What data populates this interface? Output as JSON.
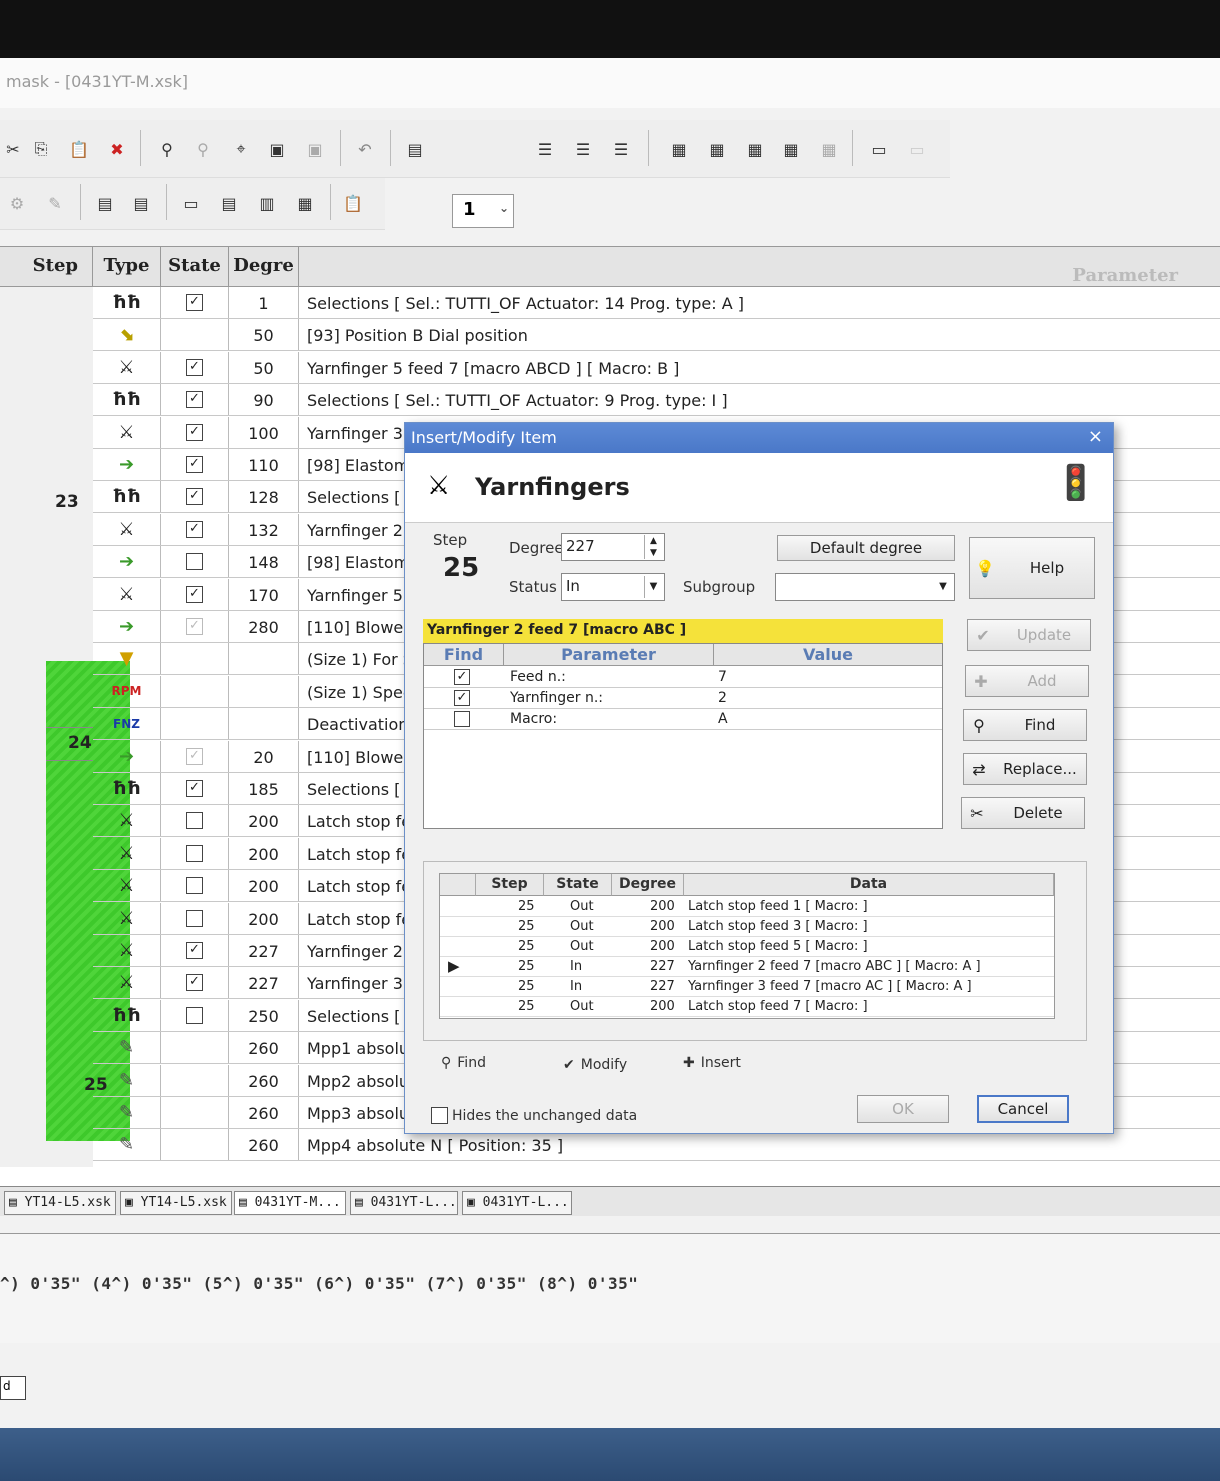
{
  "window_title": "mask - [0431YT-M.xsk]",
  "toolbar": {
    "page_combo_value": "1"
  },
  "grid": {
    "headers": {
      "step": "Step",
      "type": "Type",
      "state": "State",
      "degree": "Degre",
      "parameter": "Parameter"
    },
    "step_labels": {
      "s23": "23",
      "s24": "24",
      "s25": "25"
    },
    "rows": [
      {
        "type": "hh",
        "state": "checked",
        "degree": "1",
        "param": "Selections [ Sel.: TUTTI_OF Actuator: 14 Prog. type: A ]"
      },
      {
        "type": "dial",
        "state": "",
        "degree": "50",
        "param": "[93] Position B Dial position"
      },
      {
        "type": "yarn",
        "state": "checked",
        "degree": "50",
        "param": "Yarnfinger 5 feed 7 [macro ABCD ] [ Macro: B ]"
      },
      {
        "type": "hh",
        "state": "checked",
        "degree": "90",
        "param": "Selections [ Sel.: TUTTI_OF Actuator: 9 Prog. type: I ]"
      },
      {
        "type": "yarn",
        "state": "checked",
        "degree": "100",
        "param": "Yarnfinger 3"
      },
      {
        "type": "arrow",
        "state": "checked",
        "degree": "110",
        "param": "[98] Elastom"
      },
      {
        "type": "hh",
        "state": "checked",
        "degree": "128",
        "param": "Selections ["
      },
      {
        "type": "yarn",
        "state": "checked",
        "degree": "132",
        "param": "Yarnfinger 2"
      },
      {
        "type": "arrow",
        "state": "unchecked",
        "degree": "148",
        "param": "[98] Elastom"
      },
      {
        "type": "yarn",
        "state": "checked",
        "degree": "170",
        "param": "Yarnfinger 5"
      },
      {
        "type": "arrow",
        "state": "dim",
        "degree": "280",
        "param": "[110] Blower"
      },
      {
        "type": "size",
        "state": "",
        "degree": "",
        "param": "(Size 1) For S"
      },
      {
        "type": "rpm",
        "state": "",
        "degree": "",
        "param": "(Size 1) Spee"
      },
      {
        "type": "fnz",
        "state": "",
        "degree": "",
        "param": "Deactivation"
      },
      {
        "type": "arrow",
        "state": "dim",
        "degree": "20",
        "param": "[110] Blower"
      },
      {
        "type": "hh",
        "state": "checked",
        "degree": "185",
        "param": "Selections ["
      },
      {
        "type": "yarn",
        "state": "unchecked",
        "degree": "200",
        "param": "Latch stop fe"
      },
      {
        "type": "yarn",
        "state": "unchecked",
        "degree": "200",
        "param": "Latch stop fe"
      },
      {
        "type": "yarn",
        "state": "unchecked",
        "degree": "200",
        "param": "Latch stop fe"
      },
      {
        "type": "yarn",
        "state": "unchecked",
        "degree": "200",
        "param": "Latch stop fe"
      },
      {
        "type": "yarn",
        "state": "checked",
        "degree": "227",
        "param": "Yarnfinger 2"
      },
      {
        "type": "yarn",
        "state": "checked",
        "degree": "227",
        "param": "Yarnfinger 3"
      },
      {
        "type": "hh",
        "state": "unchecked",
        "degree": "250",
        "param": "Selections ["
      },
      {
        "type": "mpp",
        "state": "",
        "degree": "260",
        "param": "Mpp1 absolu"
      },
      {
        "type": "mpp",
        "state": "",
        "degree": "260",
        "param": "Mpp2 absolu"
      },
      {
        "type": "mpp",
        "state": "",
        "degree": "260",
        "param": "Mpp3 absolu"
      },
      {
        "type": "mpp",
        "state": "",
        "degree": "260",
        "param": "Mpp4 absolute N [ Position: 35 ]"
      }
    ]
  },
  "tabs": [
    "YT14-L5.xsk",
    "YT14-L5.xsk",
    "0431YT-M...",
    "0431YT-L...",
    "0431YT-L..."
  ],
  "timers": "^) 0'35\"   (4^) 0'35\"   (5^) 0'35\"   (6^) 0'35\"   (7^) 0'35\"   (8^) 0'35\"",
  "statusbar_text": "d",
  "dialog": {
    "title": "Insert/Modify Item",
    "close": "×",
    "heading": "Yarnfingers",
    "step_label": "Step",
    "step_value": "25",
    "degree_label": "Degree",
    "degree_value": "227",
    "default_degree": "Default degree",
    "status_label": "Status",
    "status_value": "In",
    "subgroup_label": "Subgroup",
    "subgroup_value": "",
    "help": "Help",
    "update": "Update",
    "add": "Add",
    "find": "Find",
    "replace": "Replace...",
    "delete": "Delete",
    "item_name": "Yarnfinger 2 feed 7 [macro ABC ]",
    "param_headers": {
      "find": "Find",
      "parameter": "Parameter",
      "value": "Value"
    },
    "params": [
      {
        "find": "checked",
        "parameter": "Feed n.:",
        "value": "7"
      },
      {
        "find": "checked",
        "parameter": "Yarnfinger n.:",
        "value": "2"
      },
      {
        "find": "unchecked",
        "parameter": "Macro:",
        "value": "A"
      }
    ],
    "hist_headers": {
      "step": "Step",
      "state": "State",
      "degree": "Degree",
      "data": "Data"
    },
    "hist_rows": [
      {
        "step": "25",
        "state": "Out",
        "degree": "200",
        "data": "Latch stop feed 1 [ Macro:   ]"
      },
      {
        "step": "25",
        "state": "Out",
        "degree": "200",
        "data": "Latch stop feed 3 [ Macro:   ]"
      },
      {
        "step": "25",
        "state": "Out",
        "degree": "200",
        "data": "Latch stop feed 5 [ Macro:   ]"
      },
      {
        "step": "25",
        "state": "In",
        "degree": "227",
        "data": "Yarnfinger 2 feed 7 [macro ABC ] [ Macro: A ]"
      },
      {
        "step": "25",
        "state": "In",
        "degree": "227",
        "data": "Yarnfinger 3 feed 7 [macro AC ] [ Macro: A ]"
      },
      {
        "step": "25",
        "state": "Out",
        "degree": "200",
        "data": "Latch stop feed 7 [ Macro:   ]"
      }
    ],
    "current_marker": "▶",
    "find_link": "Find",
    "modify_link": "Modify",
    "insert_link": "Insert",
    "hides_unchanged": "Hides the unchanged data",
    "ok": "OK",
    "cancel": "Cancel"
  }
}
